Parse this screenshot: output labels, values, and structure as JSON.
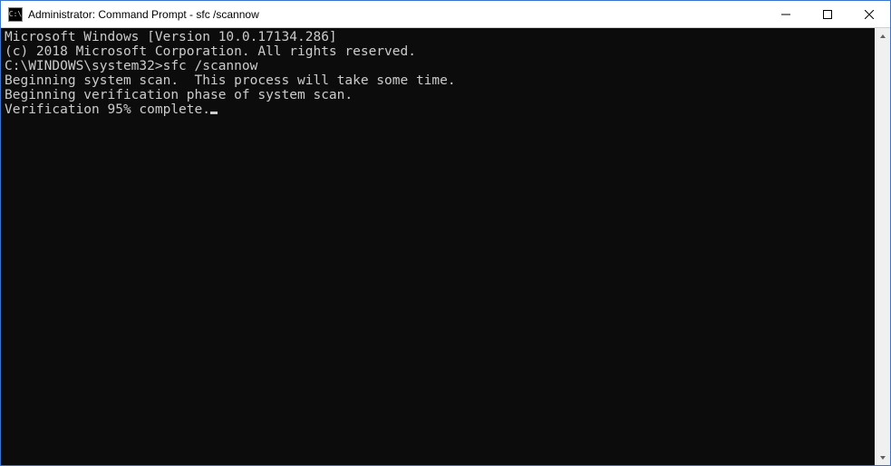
{
  "titlebar": {
    "icon_label": "C:\\",
    "title": "Administrator: Command Prompt - sfc  /scannow"
  },
  "terminal": {
    "line1": "Microsoft Windows [Version 10.0.17134.286]",
    "line2": "(c) 2018 Microsoft Corporation. All rights reserved.",
    "blank1": "",
    "prompt_line": "C:\\WINDOWS\\system32>sfc /scannow",
    "blank2": "",
    "line3": "Beginning system scan.  This process will take some time.",
    "blank3": "",
    "line4": "Beginning verification phase of system scan.",
    "line5": "Verification 95% complete."
  }
}
